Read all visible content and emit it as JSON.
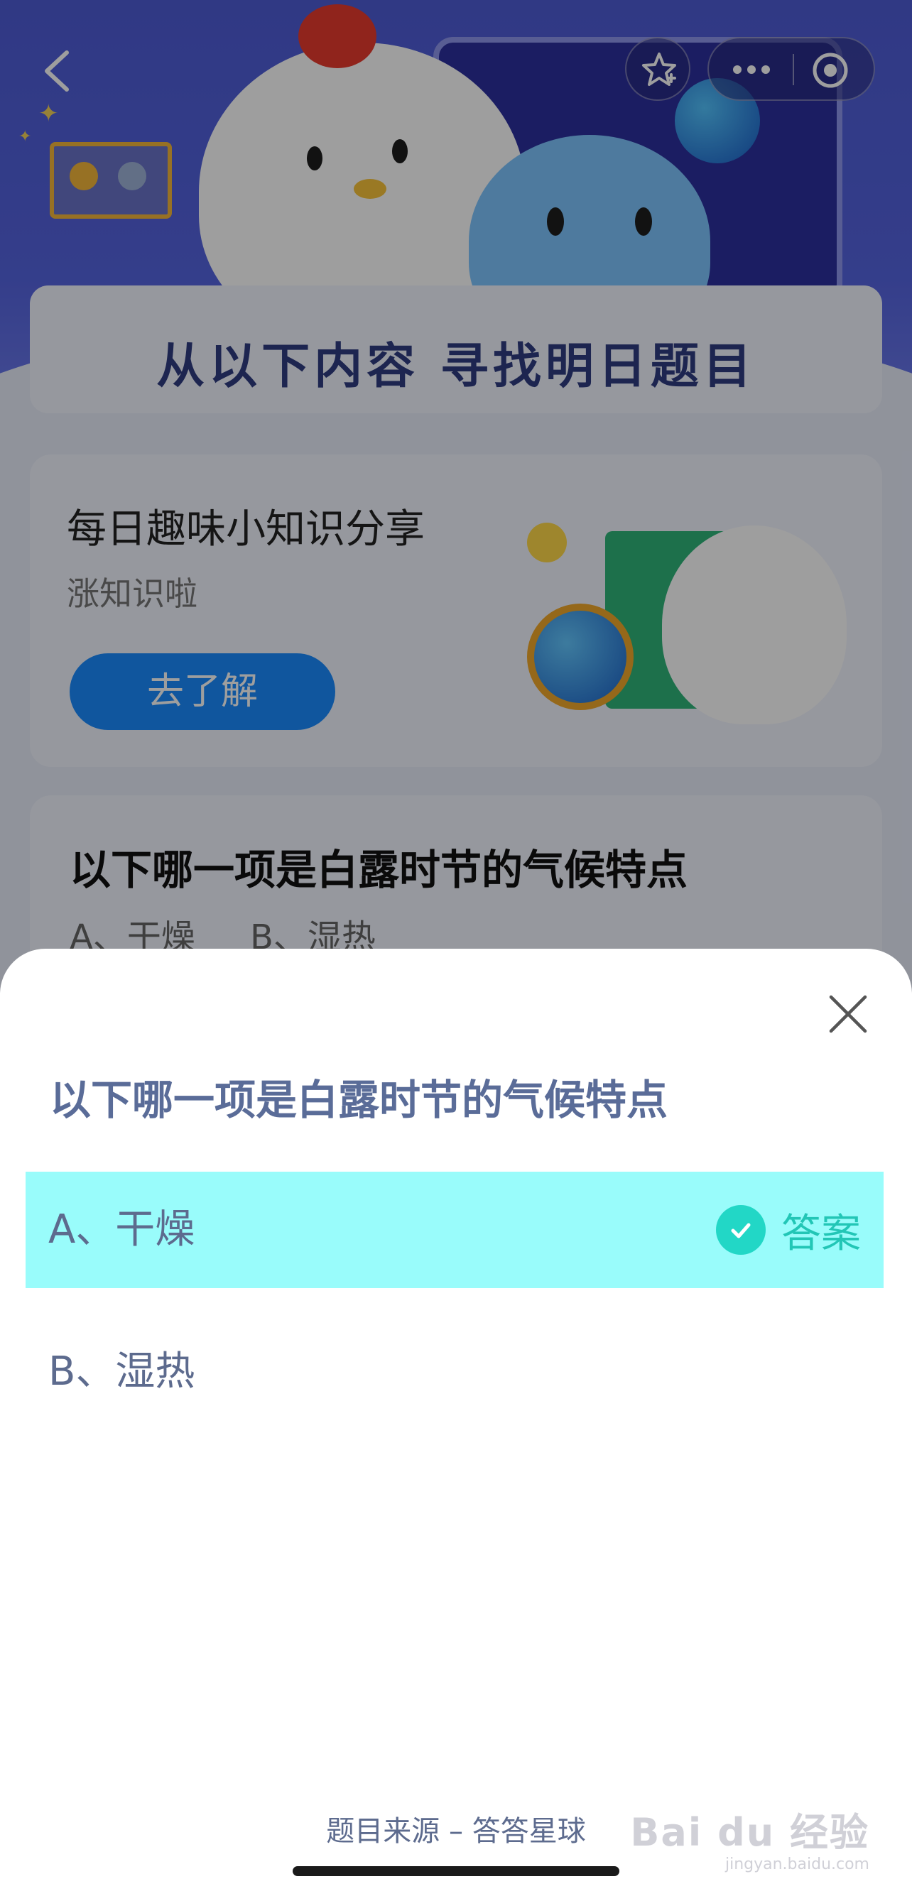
{
  "banner": {
    "title": "从以下内容 寻找明日题目"
  },
  "knowledge_card": {
    "title": "每日趣味小知识分享",
    "subtitle": "涨知识啦",
    "button_label": "去了解"
  },
  "preview_card": {
    "question": "以下哪一项是白露时节的气候特点",
    "option_a": "A、干燥",
    "option_b": "B、湿热"
  },
  "sheet": {
    "question": "以下哪一项是白露时节的气候特点",
    "options": [
      {
        "label": "A、干燥",
        "is_answer": true
      },
      {
        "label": "B、湿热",
        "is_answer": false
      }
    ],
    "answer_label": "答案",
    "source": "题目来源 – 答答星球",
    "highlight_color": "#99fcfb",
    "answer_color": "#22c6b6"
  },
  "icons": {
    "back": "chevron-left-icon",
    "favorite": "star-icon",
    "more": "more-dots-icon",
    "close_app": "target-circle-icon",
    "close_sheet": "close-icon",
    "answer_check": "check-circle-icon"
  },
  "watermark": {
    "brand": "Bai du 经验",
    "url": "jingyan.baidu.com"
  }
}
